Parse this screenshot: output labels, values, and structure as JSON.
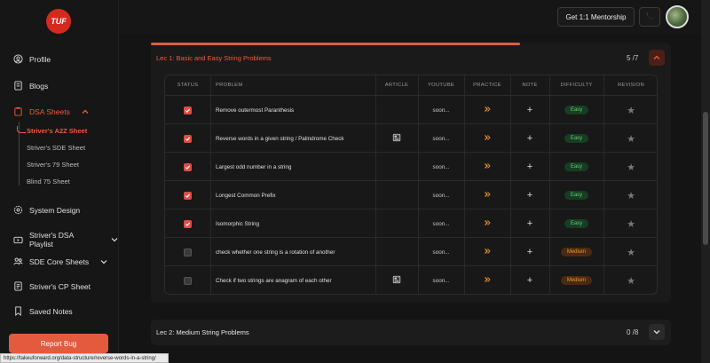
{
  "logo": {
    "text": "TUF"
  },
  "sidebar": {
    "items": [
      {
        "label": "Profile",
        "icon": "user-circle-icon"
      },
      {
        "label": "Blogs",
        "icon": "book-icon"
      },
      {
        "label": "DSA Sheets",
        "icon": "clipboard-icon"
      },
      {
        "label": "System Design",
        "icon": "gear-icon"
      },
      {
        "label": "Striver's DSA Playlist",
        "icon": "youtube-icon"
      },
      {
        "label": "SDE Core Sheets",
        "icon": "users-icon"
      },
      {
        "label": "Striver's CP Sheet",
        "icon": "sheet-icon"
      },
      {
        "label": "Saved Notes",
        "icon": "bookmark-icon"
      }
    ],
    "sheets": [
      {
        "label": "Striver's A2Z Sheet"
      },
      {
        "label": "Striver's SDE Sheet"
      },
      {
        "label": "Striver's 79 Sheet"
      },
      {
        "label": "Blind 75 Sheet"
      }
    ],
    "report_bug": "Report Bug"
  },
  "header": {
    "mentorship": "Get 1:1 Mentorship"
  },
  "lecture1": {
    "title": "Lec 1: Basic and Easy String Problems",
    "count": "5 /7",
    "progress": 0.71
  },
  "lecture2": {
    "title": "Lec 2: Medium String Problems",
    "count": "0 /8"
  },
  "table": {
    "headers": [
      "STATUS",
      "PROBLEM",
      "ARTICLE",
      "YOUTUBE",
      "PRACTICE",
      "NOTE",
      "DIFFICULTY",
      "REVISION"
    ],
    "rows": [
      {
        "done": true,
        "problem": "Remove outermost Paranthesis",
        "article": false,
        "youtube": "soon...",
        "difficulty": "Easy"
      },
      {
        "done": true,
        "problem": "Reverse words in a given string / Palindrome Check",
        "article": true,
        "youtube": "soon...",
        "difficulty": "Easy"
      },
      {
        "done": true,
        "problem": "Largest odd number in a string",
        "article": false,
        "youtube": "soon...",
        "difficulty": "Easy"
      },
      {
        "done": true,
        "problem": "Longest Common Prefix",
        "article": false,
        "youtube": "soon...",
        "difficulty": "Easy"
      },
      {
        "done": true,
        "problem": "Isomorphic String",
        "article": false,
        "youtube": "soon...",
        "difficulty": "Easy"
      },
      {
        "done": false,
        "problem": "check whether one string is a rotation of another",
        "article": false,
        "youtube": "soon...",
        "difficulty": "Medium"
      },
      {
        "done": false,
        "problem": "Check if two strings are anagram of each other",
        "article": true,
        "youtube": "soon...",
        "difficulty": "Medium"
      }
    ]
  },
  "statusbar": {
    "url": "https://takeuforward.org/data-structure/reverse-words-in-a-string/"
  }
}
